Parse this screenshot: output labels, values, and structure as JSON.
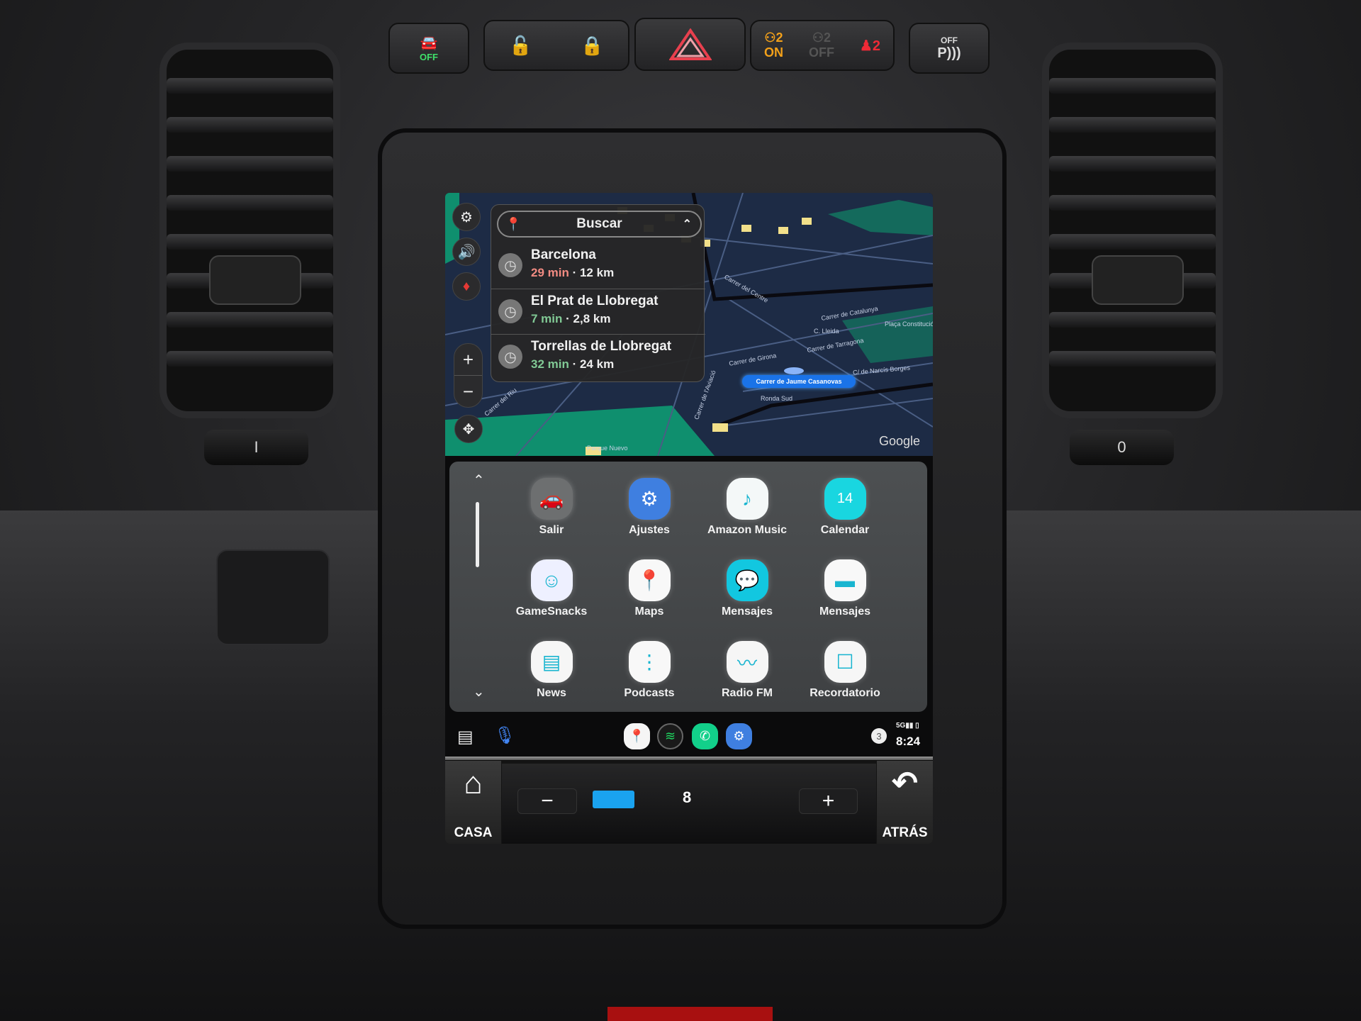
{
  "hardware": {
    "esp_off_label": "OFF",
    "airbag_on_label": "ON",
    "airbag_off_label": "OFF",
    "park_off_label": "OFF",
    "park_label": "P",
    "left_knob": "I",
    "right_knob": "0"
  },
  "map": {
    "search_label": "Buscar",
    "attribution": "Google",
    "current_street": "Carrer de Jaume Casanovas",
    "street_labels": [
      "Parque Nuevo",
      "Carrer de Girona",
      "C. Lleida",
      "Carrer de Tarragona",
      "Carrer de Catalunya",
      "C/ de Narcís Borges",
      "Ronda Sud",
      "Carrer de l'Aviació",
      "Carrer del Riu",
      "Carrer del Centre",
      "Plaça Constitució"
    ],
    "recent_destinations": [
      {
        "name": "Barcelona",
        "time": "29 min",
        "distance": "· 12 km",
        "time_color": "#f28b82"
      },
      {
        "name": "El Prat de Llobregat",
        "time": "7 min",
        "distance": "· 2,8 km",
        "time_color": "#81c995"
      },
      {
        "name": "Torrellas de Llobregat",
        "time": "32 min",
        "distance": "· 24 km",
        "time_color": "#81c995"
      }
    ]
  },
  "launcher": {
    "apps": [
      {
        "label": "Salir",
        "icon": "car-icon",
        "bg": "#6d6f70"
      },
      {
        "label": "Ajustes",
        "icon": "gear-icon",
        "bg": "#3f7fe0"
      },
      {
        "label": "Amazon Music",
        "icon": "amazon-music-icon",
        "bg": "#f4f8f8"
      },
      {
        "label": "Calendar",
        "icon": "calendar-icon",
        "bg": "#19d6e0"
      },
      {
        "label": "GameSnacks",
        "icon": "gamesnacks-icon",
        "bg": "#eef0ff"
      },
      {
        "label": "Maps",
        "icon": "maps-icon",
        "bg": "#f8f8f8"
      },
      {
        "label": "Mensajes",
        "icon": "messages-icon",
        "bg": "#12c7e0"
      },
      {
        "label": "Mensajes",
        "icon": "messages-bubble-icon",
        "bg": "#f8f8f8"
      },
      {
        "label": "News",
        "icon": "news-icon",
        "bg": "#f6f6f6"
      },
      {
        "label": "Podcasts",
        "icon": "podcasts-icon",
        "bg": "#f8f8f8"
      },
      {
        "label": "Radio FM",
        "icon": "radio-fm-icon",
        "bg": "#f6f6f6"
      },
      {
        "label": "Recordatorio",
        "icon": "reminder-icon",
        "bg": "#f6f6f6"
      }
    ],
    "calendar_day": "14"
  },
  "dock": {
    "apps": [
      "maps-icon",
      "spotify-icon",
      "phone-icon",
      "settings-icon"
    ],
    "notification_count": "3",
    "network": "5G",
    "time": "8:24"
  },
  "head_unit": {
    "home_label": "CASA",
    "back_label": "ATRÁS",
    "volume_minus": "−",
    "volume_plus": "+",
    "volume_value": "8",
    "accent": "#1aa3f0"
  }
}
